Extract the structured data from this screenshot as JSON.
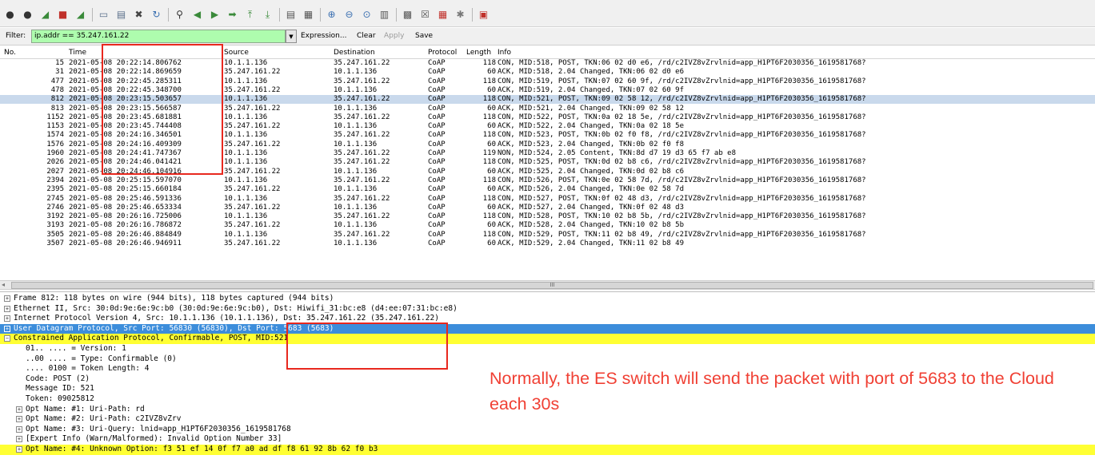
{
  "toolbar": {
    "groups": [
      [
        "interface-list-icon",
        "capture-options-icon",
        "start-capture-icon",
        "stop-capture-icon",
        "restart-capture-icon"
      ],
      [
        "open-file-icon",
        "save-file-icon",
        "close-file-icon",
        "reload-icon"
      ],
      [
        "find-icon",
        "back-icon",
        "forward-icon",
        "go-to-packet-icon",
        "first-packet-icon",
        "last-packet-icon"
      ],
      [
        "colorize-icon",
        "autoscroll-icon"
      ],
      [
        "zoom-in-icon",
        "zoom-out-icon",
        "normal-size-icon",
        "resize-columns-icon"
      ],
      [
        "capture-filters-icon",
        "display-filters-icon",
        "coloring-rules-icon",
        "preferences-icon"
      ],
      [
        "help-icon"
      ]
    ]
  },
  "filter": {
    "label": "Filter:",
    "value": "ip.addr == 35.247.161.22",
    "dropdown_glyph": "▼",
    "expression_label": "Expression...",
    "clear_label": "Clear",
    "apply_label": "Apply",
    "save_label": "Save"
  },
  "packet_list": {
    "columns": [
      "No.",
      "Time",
      "Source",
      "Destination",
      "Protocol",
      "Length",
      "Info"
    ],
    "rows": [
      [
        "15",
        "2021-05-08 20:22:14.806762",
        "10.1.1.136",
        "35.247.161.22",
        "CoAP",
        "118",
        "CON, MID:518, POST, TKN:06 02 d0 e6, /rd/c2IVZ8vZrvlnid=app_H1PT6F2030356_1619581768?"
      ],
      [
        "31",
        "2021-05-08 20:22:14.869659",
        "35.247.161.22",
        "10.1.1.136",
        "CoAP",
        "60",
        "ACK, MID:518, 2.04 Changed, TKN:06 02 d0 e6"
      ],
      [
        "477",
        "2021-05-08 20:22:45.285311",
        "10.1.1.136",
        "35.247.161.22",
        "CoAP",
        "118",
        "CON, MID:519, POST, TKN:07 02 60 9f, /rd/c2IVZ8vZrvlnid=app_H1PT6F2030356_1619581768?"
      ],
      [
        "478",
        "2021-05-08 20:22:45.348700",
        "35.247.161.22",
        "10.1.1.136",
        "CoAP",
        "60",
        "ACK, MID:519, 2.04 Changed, TKN:07 02 60 9f"
      ],
      [
        "812",
        "2021-05-08 20:23:15.503657",
        "10.1.1.136",
        "35.247.161.22",
        "CoAP",
        "118",
        "CON, MID:521, POST, TKN:09 02 58 12, /rd/c2IVZ8vZrvlnid=app_H1PT6F2030356_1619581768?"
      ],
      [
        "813",
        "2021-05-08 20:23:15.566587",
        "35.247.161.22",
        "10.1.1.136",
        "CoAP",
        "60",
        "ACK, MID:521, 2.04 Changed, TKN:09 02 58 12"
      ],
      [
        "1152",
        "2021-05-08 20:23:45.681881",
        "10.1.1.136",
        "35.247.161.22",
        "CoAP",
        "118",
        "CON, MID:522, POST, TKN:0a 02 18 5e, /rd/c2IVZ8vZrvlnid=app_H1PT6F2030356_1619581768?"
      ],
      [
        "1153",
        "2021-05-08 20:23:45.744408",
        "35.247.161.22",
        "10.1.1.136",
        "CoAP",
        "60",
        "ACK, MID:522, 2.04 Changed, TKN:0a 02 18 5e"
      ],
      [
        "1574",
        "2021-05-08 20:24:16.346501",
        "10.1.1.136",
        "35.247.161.22",
        "CoAP",
        "118",
        "CON, MID:523, POST, TKN:0b 02 f0 f8, /rd/c2IVZ8vZrvlnid=app_H1PT6F2030356_1619581768?"
      ],
      [
        "1576",
        "2021-05-08 20:24:16.409309",
        "35.247.161.22",
        "10.1.1.136",
        "CoAP",
        "60",
        "ACK, MID:523, 2.04 Changed, TKN:0b 02 f0 f8"
      ],
      [
        "1960",
        "2021-05-08 20:24:41.747367",
        "10.1.1.136",
        "35.247.161.22",
        "CoAP",
        "119",
        "NON, MID:524, 2.05 Content, TKN:8d d7 19 d3 65 f7 ab e8"
      ],
      [
        "2026",
        "2021-05-08 20:24:46.041421",
        "10.1.1.136",
        "35.247.161.22",
        "CoAP",
        "118",
        "CON, MID:525, POST, TKN:0d 02 b8 c6, /rd/c2IVZ8vZrvlnid=app_H1PT6F2030356_1619581768?"
      ],
      [
        "2027",
        "2021-05-08 20:24:46.104916",
        "35.247.161.22",
        "10.1.1.136",
        "CoAP",
        "60",
        "ACK, MID:525, 2.04 Changed, TKN:0d 02 b8 c6"
      ],
      [
        "2394",
        "2021-05-08 20:25:15.597070",
        "10.1.1.136",
        "35.247.161.22",
        "CoAP",
        "118",
        "CON, MID:526, POST, TKN:0e 02 58 7d, /rd/c2IVZ8vZrvlnid=app_H1PT6F2030356_1619581768?"
      ],
      [
        "2395",
        "2021-05-08 20:25:15.660184",
        "35.247.161.22",
        "10.1.1.136",
        "CoAP",
        "60",
        "ACK, MID:526, 2.04 Changed, TKN:0e 02 58 7d"
      ],
      [
        "2745",
        "2021-05-08 20:25:46.591336",
        "10.1.1.136",
        "35.247.161.22",
        "CoAP",
        "118",
        "CON, MID:527, POST, TKN:0f 02 48 d3, /rd/c2IVZ8vZrvlnid=app_H1PT6F2030356_1619581768?"
      ],
      [
        "2746",
        "2021-05-08 20:25:46.653334",
        "35.247.161.22",
        "10.1.1.136",
        "CoAP",
        "60",
        "ACK, MID:527, 2.04 Changed, TKN:0f 02 48 d3"
      ],
      [
        "3192",
        "2021-05-08 20:26:16.725006",
        "10.1.1.136",
        "35.247.161.22",
        "CoAP",
        "118",
        "CON, MID:528, POST, TKN:10 02 b8 5b, /rd/c2IVZ8vZrvlnid=app_H1PT6F2030356_1619581768?"
      ],
      [
        "3193",
        "2021-05-08 20:26:16.786872",
        "35.247.161.22",
        "10.1.1.136",
        "CoAP",
        "60",
        "ACK, MID:528, 2.04 Changed, TKN:10 02 b8 5b"
      ],
      [
        "3505",
        "2021-05-08 20:26:46.884849",
        "10.1.1.136",
        "35.247.161.22",
        "CoAP",
        "118",
        "CON, MID:529, POST, TKN:11 02 b8 49, /rd/c2IVZ8vZrvlnid=app_H1PT6F2030356_1619581768?"
      ],
      [
        "3507",
        "2021-05-08 20:26:46.946911",
        "35.247.161.22",
        "10.1.1.136",
        "CoAP",
        "60",
        "ACK, MID:529, 2.04 Changed, TKN:11 02 b8 49"
      ]
    ],
    "scroll_grip": "III"
  },
  "details": [
    {
      "name": "frame",
      "expander": "+",
      "indent": 0,
      "style": "",
      "text": "Frame 812: 118 bytes on wire (944 bits), 118 bytes captured (944 bits)"
    },
    {
      "name": "ethernet",
      "expander": "+",
      "indent": 0,
      "style": "",
      "text": "Ethernet II, Src: 30:0d:9e:6e:9c:b0 (30:0d:9e:6e:9c:b0), Dst: Hiwifi_31:bc:e8 (d4:ee:07:31:bc:e8)"
    },
    {
      "name": "ipv4",
      "expander": "+",
      "indent": 0,
      "style": "",
      "text": "Internet Protocol Version 4, Src: 10.1.1.136 (10.1.1.136), Dst: 35.247.161.22 (35.247.161.22)"
    },
    {
      "name": "udp",
      "expander": "+",
      "indent": 0,
      "style": "udp",
      "text": "User Datagram Protocol, Src Port: 56830 (56830), Dst Port: 5683 (5683)"
    },
    {
      "name": "coap",
      "expander": "−",
      "indent": 0,
      "style": "coap",
      "text": "Constrained Application Protocol, Confirmable, POST, MID:521"
    },
    {
      "name": "coap-version",
      "expander": "",
      "indent": 1,
      "style": "",
      "text": "01.. .... = Version: 1"
    },
    {
      "name": "coap-type",
      "expander": "",
      "indent": 1,
      "style": "",
      "text": "..00 .... = Type: Confirmable (0)"
    },
    {
      "name": "coap-token-length",
      "expander": "",
      "indent": 1,
      "style": "",
      "text": ".... 0100 = Token Length: 4"
    },
    {
      "name": "coap-code",
      "expander": "",
      "indent": 1,
      "style": "",
      "text": "Code: POST (2)"
    },
    {
      "name": "coap-message-id",
      "expander": "",
      "indent": 1,
      "style": "",
      "text": "Message ID: 521"
    },
    {
      "name": "coap-token",
      "expander": "",
      "indent": 1,
      "style": "",
      "text": "Token: 09025812"
    },
    {
      "name": "opt-1",
      "expander": "+",
      "indent": 1,
      "style": "",
      "text": "Opt Name: #1: Uri-Path: rd"
    },
    {
      "name": "opt-2",
      "expander": "+",
      "indent": 1,
      "style": "",
      "text": "Opt Name: #2: Uri-Path: c2IVZ8vZrv"
    },
    {
      "name": "opt-3",
      "expander": "+",
      "indent": 1,
      "style": "",
      "text": "Opt Name: #3: Uri-Query: lnid=app_H1PT6F2030356_1619581768"
    },
    {
      "name": "expert-info",
      "expander": "+",
      "indent": 1,
      "style": "",
      "text": "[Expert Info (Warn/Malformed): Invalid Option Number 33]"
    },
    {
      "name": "opt-4",
      "expander": "+",
      "indent": 1,
      "style": "expert",
      "text": "Opt Name: #4: Unknown Option: f3 51 ef 14 0f f7 a0 ad df f8 61 92 8b 62 f0 b3"
    }
  ],
  "annotation": {
    "text": "Normally, the ES switch will send the packet with port of 5683 to the Cloud each 30s",
    "color": "#f04034"
  },
  "colors": {
    "selected_row": "#c9d9ec",
    "udp_highlight": "#3c8ddb",
    "coap_highlight": "#ffff33",
    "filter_valid": "#aefcae",
    "red_box": "#e8281e"
  }
}
